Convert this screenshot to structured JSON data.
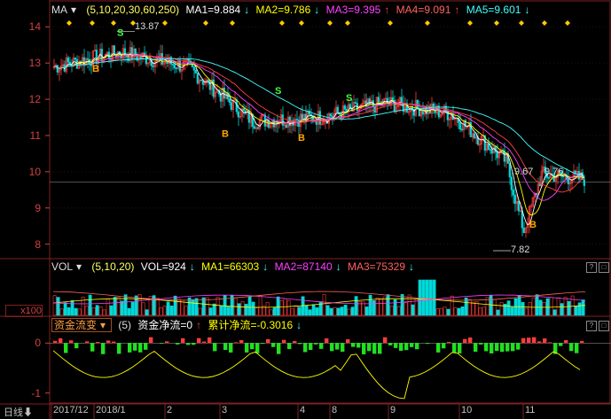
{
  "main": {
    "indicator": "MA",
    "params": "(5,10,20,30,60,250)",
    "ma1": "MA1=9.884",
    "ma2": "MA2=9.786",
    "ma3": "MA3=9.395",
    "ma4": "MA4=9.091",
    "ma5": "MA5=9.601",
    "yticks": [
      "14",
      "13",
      "12",
      "11",
      "10",
      "9",
      "8"
    ],
    "hi_label": "13.87",
    "lo_label": "7.82",
    "last_labels": [
      "9.67",
      "9.76"
    ]
  },
  "vol": {
    "indicator": "VOL",
    "params": "(5,10,20)",
    "vol": "VOL=924",
    "ma1": "MA1=66303",
    "ma2": "MA2=87140",
    "ma3": "MA3=75329",
    "unit": "x100"
  },
  "fund": {
    "indicator": "资金流变",
    "params": "(5)",
    "net": "资金净流=0",
    "cum": "累计净流=-0.3016",
    "yticks": [
      "0",
      "-1"
    ]
  },
  "xaxis": {
    "left_label": "日线",
    "labels": [
      "2017/12",
      "2018/1",
      "2",
      "3",
      "4",
      "8",
      "9",
      "10",
      "11"
    ]
  },
  "colors": {
    "up": "#ff3c3c",
    "down": "#00d8d8",
    "ma1": "#ffffff",
    "ma2": "#ffff00",
    "ma3": "#ff40ff",
    "ma4": "#ff4040",
    "ma5": "#40ffff",
    "grid": "#802020",
    "signal_b": "#ffa500",
    "signal_s": "#40ff40"
  },
  "chart_data": [
    {
      "type": "candlestick",
      "title": "MA",
      "ylim": [
        7.6,
        14.3
      ],
      "legend": [
        "MA1",
        "MA2",
        "MA3",
        "MA4",
        "MA5"
      ],
      "x": [
        "2017/12",
        "2018/1",
        "2",
        "3",
        "4",
        "8",
        "9",
        "10",
        "11"
      ],
      "close": [
        12.9,
        13.3,
        12.9,
        11.4,
        11.5,
        11.9,
        11.6,
        10.0,
        9.8
      ],
      "ma_last": [
        9.884,
        9.786,
        9.395,
        9.091,
        9.601
      ],
      "high": 13.87,
      "low": 7.82
    },
    {
      "type": "bar",
      "title": "VOL",
      "legend": [
        "VOL",
        "MA1",
        "MA2",
        "MA3"
      ],
      "last": [
        924,
        66303,
        87140,
        75329
      ]
    },
    {
      "type": "bar",
      "title": "资金流变",
      "ylim": [
        -1.2,
        0.2
      ],
      "legend": [
        "资金净流",
        "累计净流"
      ],
      "last": [
        0,
        -0.3016
      ]
    }
  ]
}
